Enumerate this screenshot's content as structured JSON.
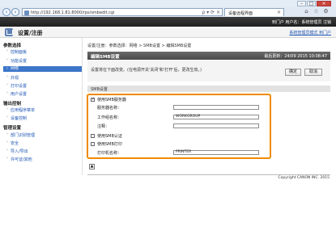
{
  "browser": {
    "address": "http://192.168.1.81:8000/rps/smbedit.cgi",
    "address_tools": "ρ ▾ ⟳ ×",
    "tab_title": "设备远程界面",
    "tab_close": "×",
    "back_icon": "back-arrow-icon",
    "forward_icon": "forward-arrow-icon",
    "window_buttons": [
      "–",
      "□",
      "×"
    ],
    "tools": [
      "⌂",
      "☆",
      "⚙"
    ]
  },
  "app_header": {
    "text": "到门户  用户名：系统管理员  注销"
  },
  "page_title_bar": {
    "title": "设置/注册",
    "top_link": "系统管理员模式  到门户"
  },
  "sidebar": {
    "sections": [
      {
        "title": "参数选择",
        "items": [
          "控制面板",
          "功能设置",
          "网络",
          "外观",
          "打印设置",
          "用户设置"
        ]
      },
      {
        "title": "输出控制",
        "items": [
          "应用程序菜单",
          "设备控制"
        ]
      },
      {
        "title": "管理设置",
        "items": [
          "部门识别管理",
          "安全",
          "导入/导出",
          "许可证/其他"
        ]
      }
    ],
    "active_item": "网络"
  },
  "breadcrumb": "设置/注册：参数选择：网络 > SMB设置 > 编辑SMB设置",
  "edit_header": {
    "title": "编辑SMB设置",
    "timestamp": "最后更新：24/09 2015 10:08:47"
  },
  "instructions": "设置将在下面改变。(在电源开关'关闭'和'打开'后，更改生效。)",
  "buttons": {
    "ok": "确定",
    "cancel": "取消"
  },
  "section_title": "SMB设置",
  "form": {
    "use_smb_server": {
      "label": "使用SMB服务器",
      "checked": true
    },
    "server_name": {
      "label": "服务器名称：",
      "value": ""
    },
    "workgroup_name": {
      "label": "工作组名称：",
      "value": "WORKGROUP"
    },
    "comment": {
      "label": "注释：",
      "value": ""
    },
    "use_smb_auth": {
      "label": "使用SMB认证",
      "checked": false
    },
    "use_smb_print": {
      "label": "使用SMB打印",
      "checked": false
    },
    "printer_name": {
      "label": "打印机名称：",
      "value": "PRINTER"
    }
  },
  "scroll_top_icon": "top-arrow-icon",
  "copyright": "Copyright CANON INC. 2015",
  "colors": {
    "accent": "#3d76c9",
    "highlight_border": "#f08a00",
    "link": "#1f56b5"
  }
}
